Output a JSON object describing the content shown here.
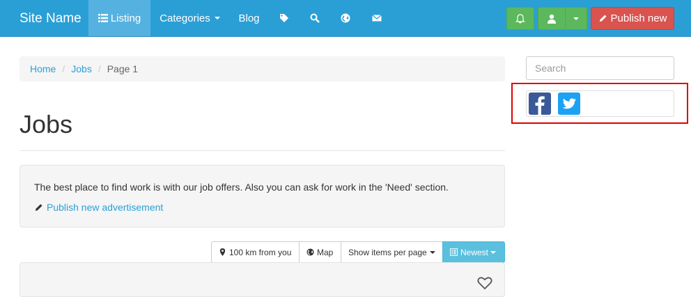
{
  "navbar": {
    "brand": "Site Name",
    "listing": "Listing",
    "categories": "Categories",
    "blog": "Blog",
    "icons": [
      "tag-icon",
      "search-icon",
      "globe-icon",
      "envelope-icon"
    ],
    "publish": "Publish new"
  },
  "breadcrumb": {
    "home": "Home",
    "jobs": "Jobs",
    "current": "Page 1"
  },
  "page": {
    "title": "Jobs",
    "description": "The best place to find work is with our job offers. Also you can ask for work in the 'Need' section.",
    "publish_link": "Publish new advertisement"
  },
  "toolbar": {
    "distance": "100 km from you",
    "map": "Map",
    "per_page": "Show items per page",
    "sort": "Newest"
  },
  "sidebar": {
    "search_placeholder": "Search"
  },
  "colors": {
    "navbar": "#2a9fd6",
    "success": "#5cb85c",
    "danger": "#d9534f",
    "info": "#5bc0de",
    "facebook": "#3b5998",
    "twitter": "#1da1f2",
    "highlight": "#e00000"
  }
}
